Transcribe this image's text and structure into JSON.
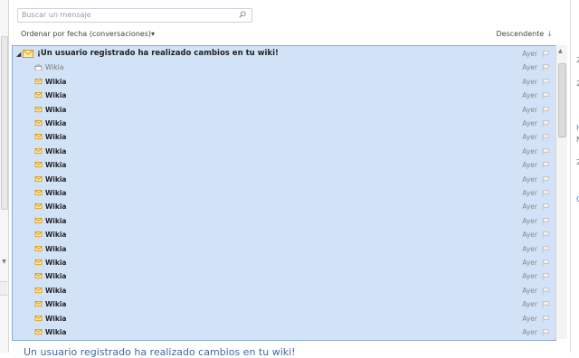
{
  "search": {
    "placeholder": "Buscar un mensaje"
  },
  "sort": {
    "left_label": "Ordenar por fecha (conversaciones)",
    "left_caret": "▾",
    "right_label": "Descendente",
    "right_arrow": "↓"
  },
  "conversation": {
    "subject": "¡Un usuario registrado ha realizado cambios en tu wiki!",
    "date": "Ayer",
    "messages": [
      {
        "sender": "Wikia",
        "date": "Ayer",
        "read": true
      },
      {
        "sender": "Wikia",
        "date": "Ayer",
        "read": false
      },
      {
        "sender": "Wikia",
        "date": "Ayer",
        "read": false
      },
      {
        "sender": "Wikia",
        "date": "Ayer",
        "read": false
      },
      {
        "sender": "Wikia",
        "date": "Ayer",
        "read": false
      },
      {
        "sender": "Wikia",
        "date": "Ayer",
        "read": false
      },
      {
        "sender": "Wikia",
        "date": "Ayer",
        "read": false
      },
      {
        "sender": "Wikia",
        "date": "Ayer",
        "read": false
      },
      {
        "sender": "Wikia",
        "date": "Ayer",
        "read": false
      },
      {
        "sender": "Wikia",
        "date": "Ayer",
        "read": false
      },
      {
        "sender": "Wikia",
        "date": "Ayer",
        "read": false
      },
      {
        "sender": "Wikia",
        "date": "Ayer",
        "read": false
      },
      {
        "sender": "Wikia",
        "date": "Ayer",
        "read": false
      },
      {
        "sender": "Wikia",
        "date": "Ayer",
        "read": false
      },
      {
        "sender": "Wikia",
        "date": "Ayer",
        "read": false
      },
      {
        "sender": "Wikia",
        "date": "Ayer",
        "read": false
      },
      {
        "sender": "Wikia",
        "date": "Ayer",
        "read": false
      },
      {
        "sender": "Wikia",
        "date": "Ayer",
        "read": false
      },
      {
        "sender": "Wikia",
        "date": "Ayer",
        "read": false
      },
      {
        "sender": "Wikia",
        "date": "Ayer",
        "read": false
      }
    ]
  },
  "reading_pane": {
    "title_partial": "Un usuario registrado ha realizado cambios en tu wiki!"
  },
  "right_panel": {
    "items": [
      "2",
      "2",
      "H",
      "N",
      "2",
      "C"
    ]
  },
  "colors": {
    "selection_bg": "#d2e3f8",
    "selection_border": "#87a9d4",
    "envelope": "#f0b82a",
    "accent": "#3e6b9d"
  }
}
